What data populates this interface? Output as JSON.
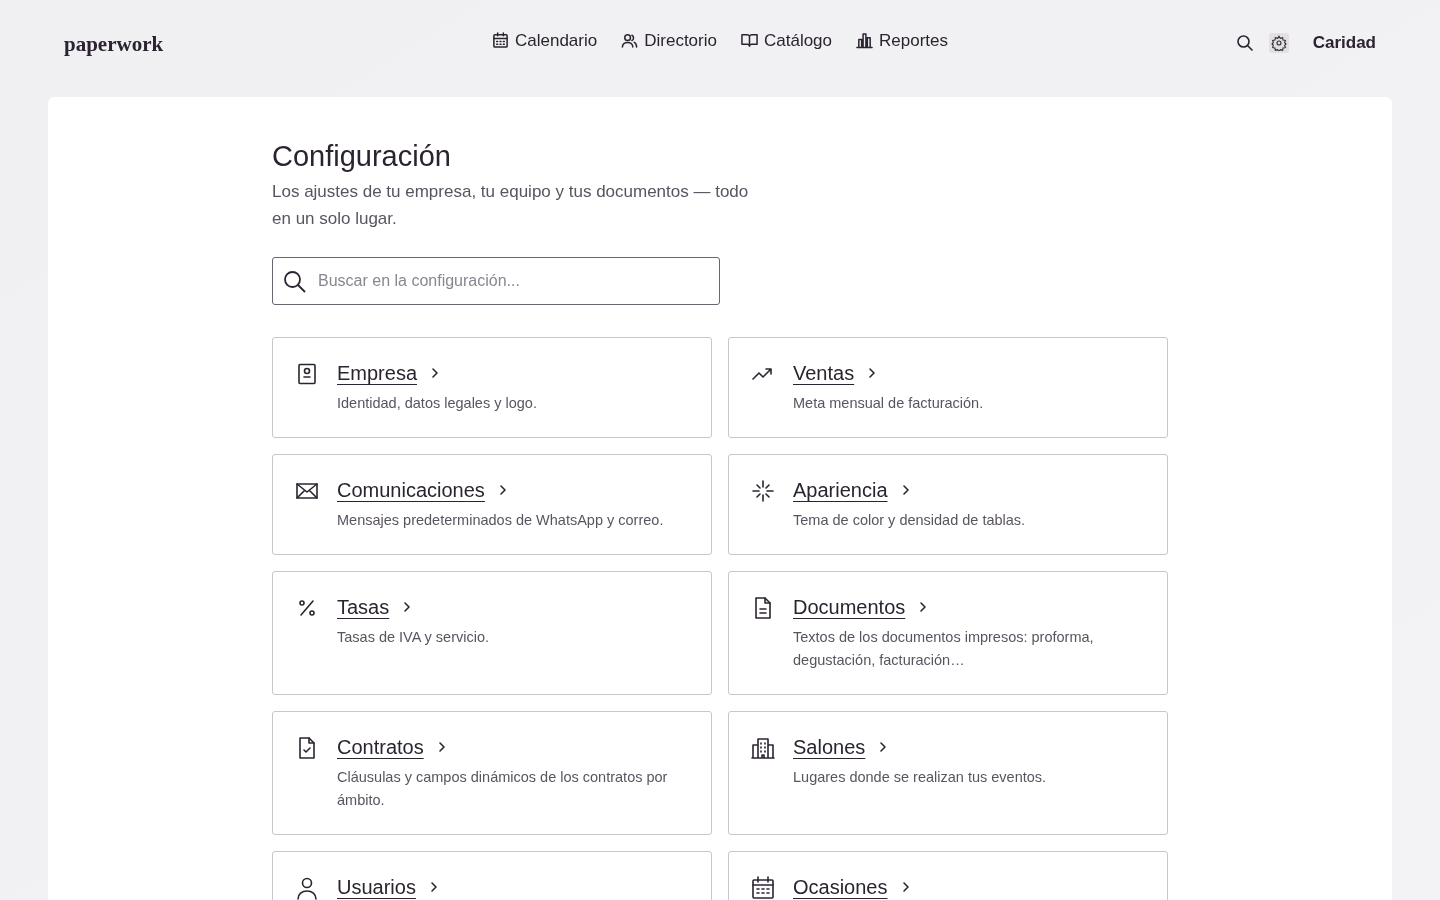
{
  "header": {
    "logo": "paperwork",
    "nav": [
      {
        "label": "Calendario",
        "kind": "calendar"
      },
      {
        "label": "Directorio",
        "kind": "people"
      },
      {
        "label": "Catálogo",
        "kind": "book"
      },
      {
        "label": "Reportes",
        "kind": "chart"
      }
    ],
    "settings_button": {
      "selected": true
    },
    "user": "Caridad"
  },
  "page": {
    "title": "Configuración",
    "subtitle": "Los ajustes de tu empresa, tu equipo y tus documentos — todo en un solo lugar.",
    "search": {
      "placeholder": "Buscar en la configuración..."
    },
    "cards": [
      {
        "kind": "company",
        "title": "Empresa",
        "description": "Identidad, datos legales y logo."
      },
      {
        "kind": "sales",
        "title": "Ventas",
        "description": "Meta mensual de facturación."
      },
      {
        "kind": "mail",
        "title": "Comunicaciones",
        "description": "Mensajes predeterminados de WhatsApp y correo."
      },
      {
        "kind": "appearance",
        "title": "Apariencia",
        "description": "Tema de color y densidad de tablas."
      },
      {
        "kind": "percent",
        "title": "Tasas",
        "description": "Tasas de IVA y servicio."
      },
      {
        "kind": "document",
        "title": "Documentos",
        "description": "Textos de los documentos impresos: proforma, degustación, facturación…"
      },
      {
        "kind": "contract",
        "title": "Contratos",
        "description": "Cláusulas y campos dinámicos de los contratos por ámbito."
      },
      {
        "kind": "building",
        "title": "Salones",
        "description": "Lugares donde se realizan tus eventos."
      },
      {
        "kind": "user",
        "title": "Usuarios"
      },
      {
        "kind": "calendar",
        "title": "Ocasiones"
      }
    ]
  }
}
